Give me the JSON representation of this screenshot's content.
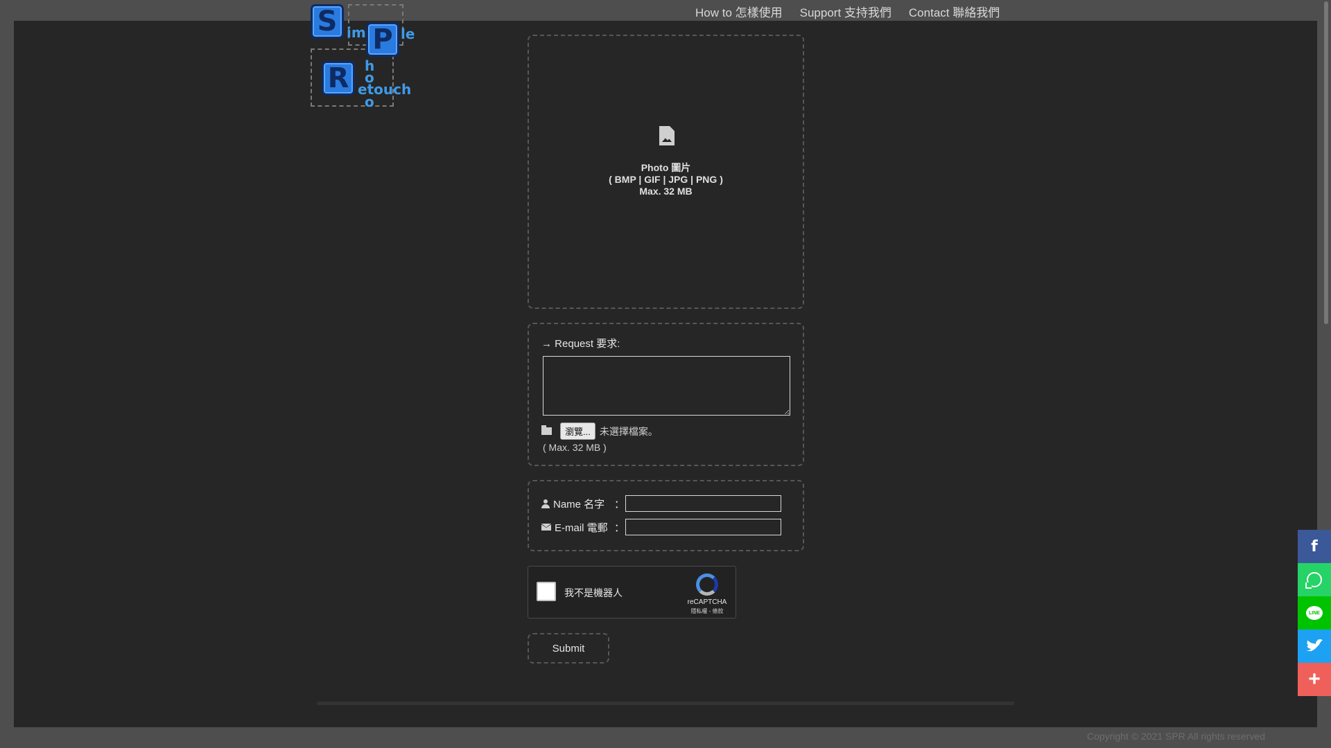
{
  "nav": {
    "howto": "How to 怎樣使用",
    "support": "Support 支持我們",
    "contact": "Contact 聯絡我們"
  },
  "logo": {
    "s": "S",
    "im": "im",
    "p": "P",
    "le": "le",
    "r": "R",
    "h": "h",
    "o": "o",
    "etouch": "etouch",
    "o2": "o"
  },
  "upload": {
    "line1": "Photo 圖片",
    "line2": "( BMP | GIF | JPG | PNG )",
    "line3": "Max. 32 MB"
  },
  "request": {
    "label": "Request 要求:",
    "value": "",
    "browse_label": "瀏覽...",
    "no_file": "未選擇檔案。",
    "max_note": "( Max. 32 MB )"
  },
  "form": {
    "name_label": "Name 名字",
    "email_label": "E-mail 電郵",
    "colon": "：",
    "name_value": "",
    "email_value": ""
  },
  "recaptcha": {
    "label": "我不是機器人",
    "brand": "reCAPTCHA",
    "links": "隱私權 - 條款"
  },
  "submit": {
    "label": "Submit"
  },
  "footer": {
    "copyright": "Copyright © 2021 SPR All rights reserved"
  },
  "share": {
    "facebook": "f",
    "line": "LINE",
    "more": "+"
  },
  "colors": {
    "page_bg": "#4e4e4e",
    "panel_bg": "#262626",
    "logo_blue": "#2a7be0",
    "facebook": "#3b5998",
    "whatsapp": "#25d366",
    "line": "#00c300",
    "twitter": "#1da1f2",
    "more": "#f0605a"
  },
  "icons": {
    "upload": "file-image-icon",
    "request": "arrow-right-icon",
    "file": "folder-icon",
    "name": "user-icon",
    "email": "envelope-icon"
  }
}
